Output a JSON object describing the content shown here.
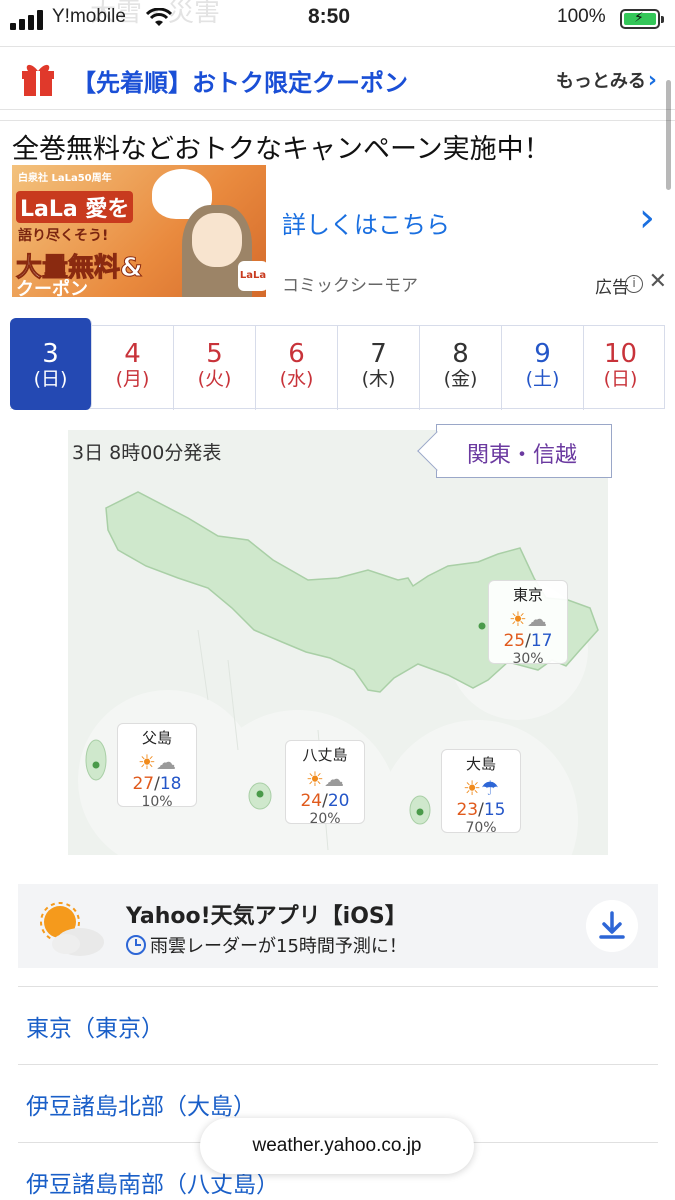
{
  "status_bar": {
    "carrier": "Y!mobile",
    "time": "8:50",
    "battery": "100%",
    "background_ghost": "大雪・災害"
  },
  "coupon_bar": {
    "text": "【先着順】おトク限定クーポン",
    "more_label": "もっとみる"
  },
  "ad": {
    "headline": "全巻無料などおトクなキャンペーン実施中！",
    "details_link": "詳しくはこちら",
    "advertiser": "コミックシーモア",
    "ad_label": "広告",
    "banner": {
      "line1": "白泉社 LaLa50周年",
      "line2": "LaLa 愛を",
      "line3": "語り尽くそう!",
      "line4": "大量無料&",
      "line5": "クーポン",
      "logo": "LaLa 50"
    }
  },
  "date_tabs": [
    {
      "day": "3",
      "weekday": "(日)",
      "selected": true,
      "color": "#ffffff"
    },
    {
      "day": "4",
      "weekday": "(月)",
      "selected": false,
      "color": "#c8333a"
    },
    {
      "day": "5",
      "weekday": "(火)",
      "selected": false,
      "color": "#c8333a"
    },
    {
      "day": "6",
      "weekday": "(水)",
      "selected": false,
      "color": "#c8333a"
    },
    {
      "day": "7",
      "weekday": "(木)",
      "selected": false,
      "color": "#333333"
    },
    {
      "day": "8",
      "weekday": "(金)",
      "selected": false,
      "color": "#333333"
    },
    {
      "day": "9",
      "weekday": "(土)",
      "selected": false,
      "color": "#2456c8"
    },
    {
      "day": "10",
      "weekday": "(日)",
      "selected": false,
      "color": "#c8333a"
    }
  ],
  "map": {
    "issued": "3日 8時00分発表",
    "region": "関東・信越",
    "points": [
      {
        "name": "東京",
        "icons": [
          "sun",
          "cloud"
        ],
        "high": "25",
        "low": "17",
        "pop": "30%"
      },
      {
        "name": "父島",
        "icons": [
          "sun",
          "cloud"
        ],
        "high": "27",
        "low": "18",
        "pop": "10%"
      },
      {
        "name": "八丈島",
        "icons": [
          "sun",
          "cloud"
        ],
        "high": "24",
        "low": "20",
        "pop": "20%"
      },
      {
        "name": "大島",
        "icons": [
          "sun",
          "umbrella"
        ],
        "high": "23",
        "low": "15",
        "pop": "70%"
      }
    ]
  },
  "app_banner": {
    "title": "Yahoo!天気アプリ【iOS】",
    "subtitle": "雨雲レーダーが15時間予測に！"
  },
  "links": [
    "東京（東京）",
    "伊豆諸島北部（大島）",
    "伊豆諸島南部（八丈島）"
  ],
  "url": "weather.yahoo.co.jp",
  "colors": {
    "accent_blue": "#1a6fe0",
    "selected_tab": "#2449b3",
    "map_land": "#cfe8cc",
    "high_temp": "#e05a1c",
    "low_temp": "#2456c8"
  }
}
